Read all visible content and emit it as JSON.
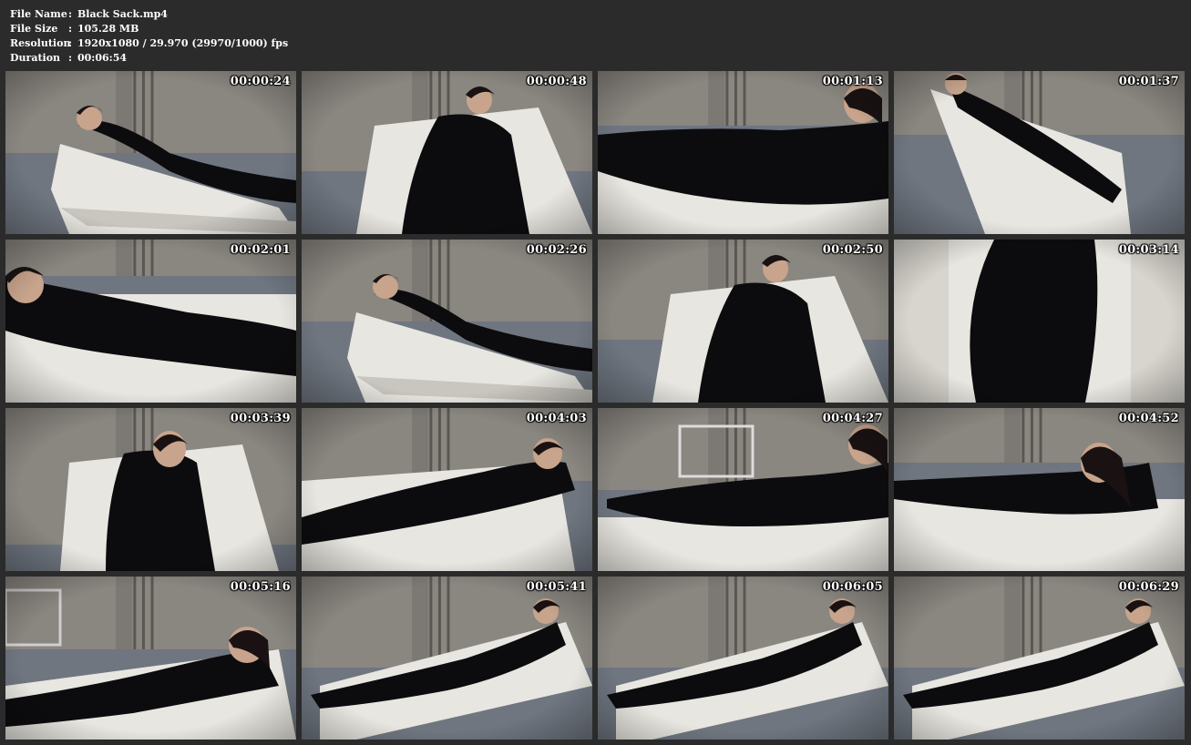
{
  "meta": {
    "rows": [
      {
        "label": "File Name",
        "sep": ":",
        "value": "Black Sack.mp4"
      },
      {
        "label": "File Size",
        "sep": ":",
        "value": "105.28 MB"
      },
      {
        "label": "Resolution",
        "sep": ":",
        "value": "1920x1080 / 29.970 (29970/1000) fps"
      },
      {
        "label": "Duration",
        "sep": ":",
        "value": "00:06:54"
      }
    ]
  },
  "thumbnails": [
    {
      "time": "00:00:24",
      "variant": "recline-left"
    },
    {
      "time": "00:00:48",
      "variant": "front-tilt"
    },
    {
      "time": "00:01:13",
      "variant": "close-right"
    },
    {
      "time": "00:01:37",
      "variant": "high-angle"
    },
    {
      "time": "00:02:01",
      "variant": "close-left"
    },
    {
      "time": "00:02:26",
      "variant": "recline-left"
    },
    {
      "time": "00:02:50",
      "variant": "front-tilt"
    },
    {
      "time": "00:03:14",
      "variant": "torso-close"
    },
    {
      "time": "00:03:39",
      "variant": "front-portrait"
    },
    {
      "time": "00:04:03",
      "variant": "side-right"
    },
    {
      "time": "00:04:27",
      "variant": "floor-wide"
    },
    {
      "time": "00:04:52",
      "variant": "close-right-low"
    },
    {
      "time": "00:05:16",
      "variant": "wide-room"
    },
    {
      "time": "00:05:41",
      "variant": "side-angle"
    },
    {
      "time": "00:06:05",
      "variant": "side-angle"
    },
    {
      "time": "00:06:29",
      "variant": "side-angle"
    }
  ],
  "colors": {
    "background": "#2b2b2b",
    "wall": "#8a8680",
    "floor": "#6f7680",
    "chair": "#e8e6e0",
    "latex": "#0c0c0e"
  }
}
